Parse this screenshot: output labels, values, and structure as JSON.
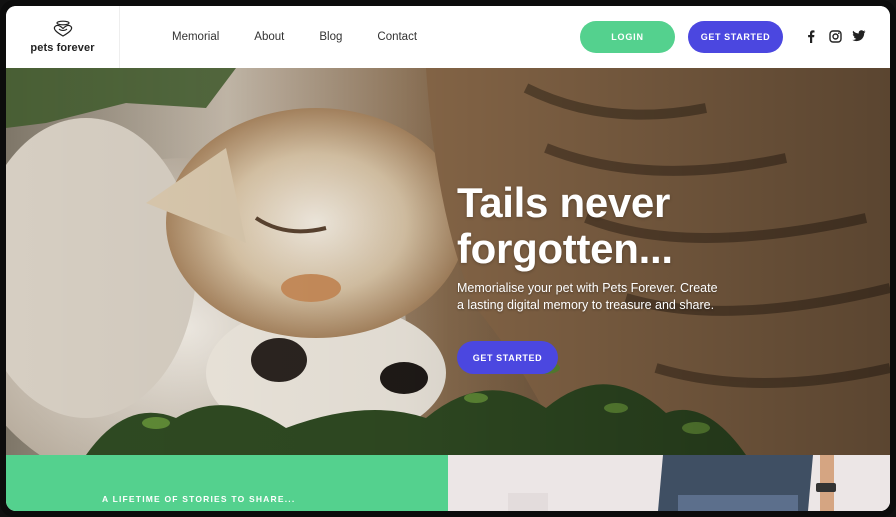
{
  "brand": {
    "name": "pets forever",
    "logo_icon": "heart-halo-icon"
  },
  "nav": {
    "items": [
      {
        "label": "Memorial"
      },
      {
        "label": "About"
      },
      {
        "label": "Blog"
      },
      {
        "label": "Contact"
      }
    ]
  },
  "header": {
    "login_label": "LOGIN",
    "get_started_label": "GET STARTED",
    "social_icons": [
      "facebook-icon",
      "instagram-icon",
      "twitter-icon"
    ]
  },
  "hero": {
    "title_line1": "Tails never",
    "title_line2": "forgotten...",
    "subtitle_line1": "Memorialise your pet with Pets Forever. Create",
    "subtitle_line2": "a lasting digital memory to treasure and share.",
    "cta_label": "GET STARTED"
  },
  "strip": {
    "label": "A LIFETIME OF STORIES TO SHARE..."
  },
  "colors": {
    "accent_green": "#54d18e",
    "accent_blue": "#4b47e0"
  }
}
